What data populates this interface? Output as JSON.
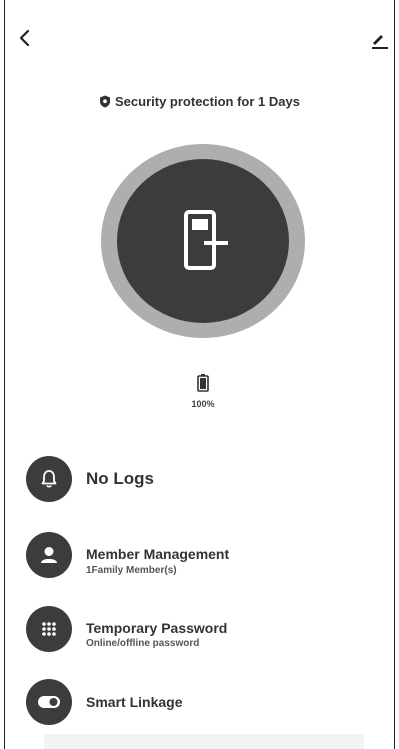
{
  "header": {
    "back_icon": "chevron-left-icon",
    "edit_icon": "pencil-icon",
    "status_text": "Security protection for 1 Days",
    "status_icon": "shield-icon"
  },
  "lock": {
    "icon": "door-lock-icon",
    "outer_ring_color": "#aeaeae",
    "inner_color": "#3c3c3c"
  },
  "battery": {
    "icon": "battery-icon",
    "level_text": "100%",
    "level_fraction": 1.0
  },
  "menu": {
    "logs": {
      "label": "No Logs",
      "icon": "bell-icon"
    },
    "members": {
      "label": "Member Management",
      "sublabel": "1Family Member(s)",
      "icon": "person-icon"
    },
    "temp_password": {
      "label": "Temporary Password",
      "sublabel": "Online/offline password",
      "icon": "keypad-icon"
    },
    "smart_linkage": {
      "label": "Smart Linkage",
      "icon": "toggle-icon"
    }
  }
}
